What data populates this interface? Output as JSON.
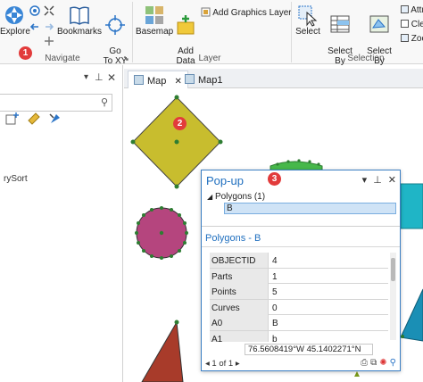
{
  "colors": {
    "accent": "#1f6fbf",
    "badge": "#e23b3b",
    "diamond_fill": "#c8bd2e",
    "circle_fill": "#b5457e",
    "green_fill": "#46b84a",
    "cyan_fill": "#1fb5c6",
    "darkred_fill": "#a83b2a",
    "teal_fill": "#1a8fb5"
  },
  "ribbon": {
    "explore_label": "Explore",
    "bookmarks_label": "Bookmarks",
    "go_to_xy_label": "Go\nTo XY",
    "basemap_label": "Basemap",
    "add_data_label": "Add\nData",
    "add_graphics_layer_label": "Add Graphics Layer",
    "select_label": "Select",
    "select_by_attributes_label": "Select By\nAttributes",
    "select_by_location_label": "Select By\nLocation",
    "attr_label": "Attr",
    "clear_label": "Clea",
    "zoom_label": "Zoo",
    "groups": {
      "navigate": "Navigate",
      "layer": "Layer",
      "selection": "Selection"
    }
  },
  "left_pane": {
    "row_text": "rySort"
  },
  "map": {
    "tabs": [
      {
        "label": "Map"
      },
      {
        "label": "Map1"
      }
    ]
  },
  "popup": {
    "title": "Pop-up",
    "tree_label": "Polygons (1)",
    "selected_item": "B",
    "feature_title": "Polygons - B",
    "fields": [
      {
        "name": "OBJECTID",
        "value": "4"
      },
      {
        "name": "Parts",
        "value": "1"
      },
      {
        "name": "Points",
        "value": "5"
      },
      {
        "name": "Curves",
        "value": "0"
      },
      {
        "name": "A0",
        "value": "B"
      },
      {
        "name": "A1",
        "value": "b"
      }
    ],
    "coordinates": "76.5608419°W 45.1402271°N",
    "nav_text": "1 of 1"
  },
  "badges": [
    "1",
    "2",
    "3"
  ]
}
